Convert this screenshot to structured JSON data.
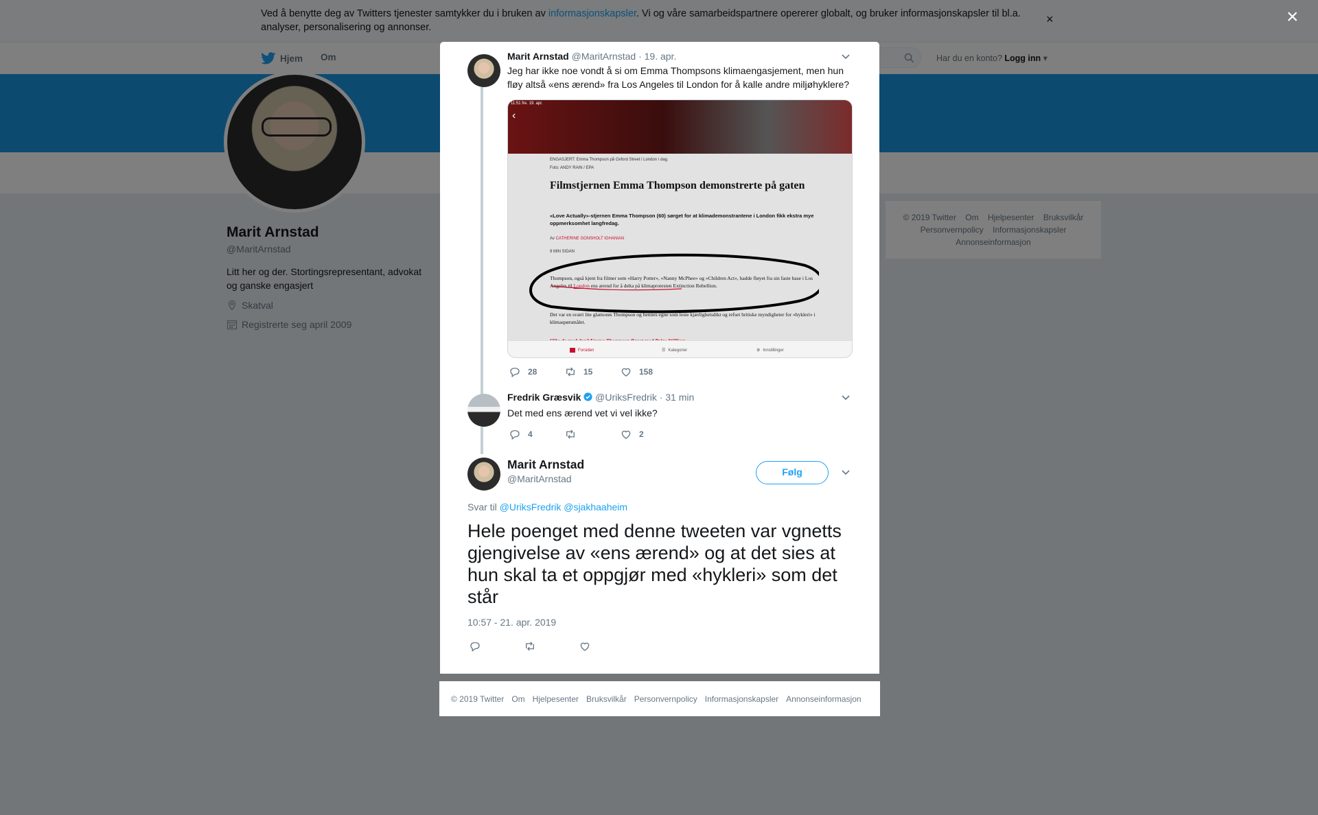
{
  "cookie": {
    "text_before": "Ved å benytte deg av Twitters tjenester samtykker du i bruken av ",
    "link": "informasjonskapsler",
    "text_after": ". Vi og våre samarbeidspartnere opererer globalt, og bruker informasjonskapsler til bl.a. analyser, personalisering og annonser.",
    "close": "×"
  },
  "nav": {
    "home": "Hjem",
    "about": "Om",
    "login_question": "Har du en konto?",
    "login": "Logg inn"
  },
  "profile": {
    "name": "Marit Arnstad",
    "handle": "@MaritArnstad",
    "bio": "Litt her og der. Stortingsrepresentant, advokat og ganske engasjert",
    "location": "Skatval",
    "joined": "Registrerte seg april 2009"
  },
  "side_footer": {
    "line1": [
      "© 2019 Twitter",
      "Om",
      "Hjelpesenter",
      "Bruksvilkår"
    ],
    "line2": [
      "Personvernpolicy",
      "Informasjonskapsler"
    ],
    "line3": [
      "Annonseinformasjon"
    ]
  },
  "modal": {
    "close": "×",
    "tweet1": {
      "name": "Marit Arnstad",
      "handle": "@MaritArnstad",
      "date": "· 19. apr.",
      "text": "Jeg har ikke noe vondt å si om Emma Thompsons klimaengasjement, men hun fløy altså «ens ærend» fra Los Angeles til London for å kalle andre miljøhyklere?",
      "replies": "28",
      "retweets": "15",
      "likes": "158",
      "media": {
        "status": "11:51 fre. 19. apr.",
        "caption1": "ENGASJERT: Emma Thompson på Oxford Street i London i dag.",
        "caption2": "Foto: ANDY RAIN / EPA",
        "headline": "Filmstjernen Emma Thompson demonstrerte på gaten",
        "lede": "«Love Actually»-stjernen Emma Thompson (60) sørget for at klimademonstrantene i London fikk ekstra mye oppmerksomhet langfredag.",
        "byline_prefix": "Av ",
        "byline_author": "CATHERINE GONSHOLT IGHANIAN",
        "read_time": "9 MIN SIDAN",
        "body1_a": "Thompson, også kjent fra filmer som «Harry Potter», «Nanny McPhee» og «Children Act», hadde fløyet fra sin faste base i Los Angeles til ",
        "body1_link": "London",
        "body1_b": " ens ærend for å delta på klimaprotesten Extinction Rebellion.",
        "body2": "Det var en svært lite glamorøs Thompson og hennes egne som leste kjærlighetsdikt og refset britiske myndigheter for «hykleri» i klimaspørsmålet.",
        "body3": "Slik: de med den? Emma Thompson fløyet med Prins William",
        "tab_home": "Forsiden",
        "tab_categories": "Kategorier",
        "tab_settings": "Innstillinger"
      }
    },
    "tweet2": {
      "name": "Fredrik Græsvik",
      "handle": "@UriksFredrik",
      "date": "· 31 min",
      "text": "Det med ens ærend vet vi vel ikke?",
      "replies": "4",
      "likes": "2"
    },
    "main_tweet": {
      "name": "Marit Arnstad",
      "handle": "@MaritArnstad",
      "follow": "Følg",
      "reply_prefix": "Svar til",
      "reply_users": "@UriksFredrik @sjakhaaheim",
      "text": "Hele poenget med denne tweeten var vgnetts gjengivelse av «ens ærend» og at det sies at hun skal ta et oppgjør med «hykleri» som det står",
      "timestamp": "10:57 - 21. apr. 2019"
    }
  },
  "modal_footer": [
    "© 2019 Twitter",
    "Om",
    "Hjelpesenter",
    "Bruksvilkår",
    "Personvernpolicy",
    "Informasjonskapsler",
    "Annonseinformasjon"
  ],
  "colors": {
    "brand_blue": "#1da1f2",
    "banner": "#1b95e0",
    "overlay": "rgba(0,0,0,0.5)"
  },
  "icons": [
    "twitter-bird-icon",
    "search-icon",
    "location-icon",
    "calendar-icon",
    "reply-icon",
    "retweet-icon",
    "like-icon",
    "verified-icon",
    "chevron-down-icon",
    "close-icon"
  ]
}
